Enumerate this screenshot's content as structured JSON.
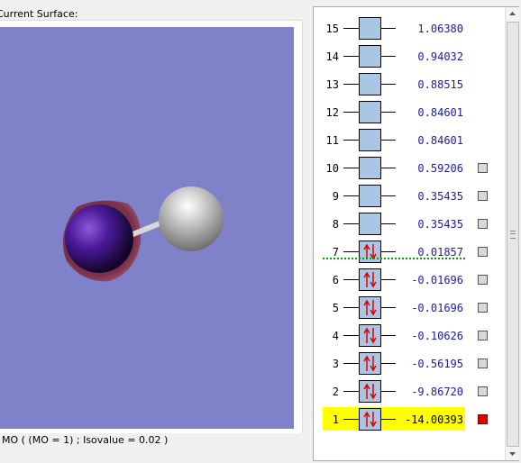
{
  "surface_label": "Current Surface:",
  "status": "MO ( (MO = 1) ; Isovalue = 0.02 )",
  "colors": {
    "viewport_bg": "#7f81c9",
    "occupied_box": "#a9c7e4",
    "energy_text": "#1a1aa8",
    "highlight": "#ffff00",
    "selected_check": "#e00000",
    "homo_lumo_line": "#00a000"
  },
  "orbitals": [
    {
      "num": "15",
      "energy": "1.06380",
      "occupied": false,
      "checkbox": false,
      "selected": false
    },
    {
      "num": "14",
      "energy": "0.94032",
      "occupied": false,
      "checkbox": false,
      "selected": false
    },
    {
      "num": "13",
      "energy": "0.88515",
      "occupied": false,
      "checkbox": false,
      "selected": false
    },
    {
      "num": "12",
      "energy": "0.84601",
      "occupied": false,
      "checkbox": false,
      "selected": false
    },
    {
      "num": "11",
      "energy": "0.84601",
      "occupied": false,
      "checkbox": false,
      "selected": false
    },
    {
      "num": "10",
      "energy": "0.59206",
      "occupied": false,
      "checkbox": true,
      "selected": false
    },
    {
      "num": "9",
      "energy": "0.35435",
      "occupied": false,
      "checkbox": true,
      "selected": false
    },
    {
      "num": "8",
      "energy": "0.35435",
      "occupied": false,
      "checkbox": true,
      "selected": false
    },
    {
      "num": "7",
      "energy": "0.01857",
      "occupied": true,
      "checkbox": true,
      "selected": false
    },
    {
      "num": "6",
      "energy": "-0.01696",
      "occupied": true,
      "checkbox": true,
      "selected": false
    },
    {
      "num": "5",
      "energy": "-0.01696",
      "occupied": true,
      "checkbox": true,
      "selected": false
    },
    {
      "num": "4",
      "energy": "-0.10626",
      "occupied": true,
      "checkbox": true,
      "selected": false
    },
    {
      "num": "3",
      "energy": "-0.56195",
      "occupied": true,
      "checkbox": true,
      "selected": false
    },
    {
      "num": "2",
      "energy": "-9.86720",
      "occupied": true,
      "checkbox": true,
      "selected": false
    },
    {
      "num": "1",
      "energy": "-14.00393",
      "occupied": true,
      "checkbox": true,
      "selected": true
    }
  ]
}
